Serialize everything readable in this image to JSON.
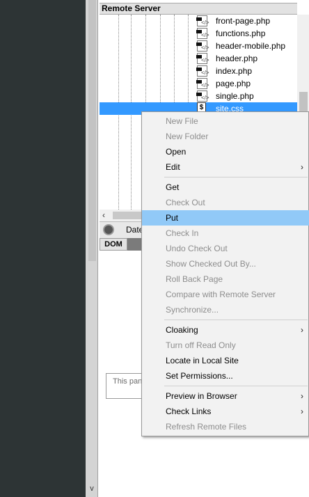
{
  "panel": {
    "title": "Remote Server",
    "files": [
      {
        "name": "front-page.php"
      },
      {
        "name": "functions.php"
      },
      {
        "name": "header-mobile.php"
      },
      {
        "name": "header.php"
      },
      {
        "name": "index.php"
      },
      {
        "name": "page.php"
      },
      {
        "name": "single.php"
      },
      {
        "name": "site.css"
      }
    ],
    "selected_file": "site.css",
    "date_column": "Date",
    "tab_dom": "DOM",
    "pane_placeholder": "This pan"
  },
  "context_menu": {
    "items": [
      {
        "label": "New File",
        "enabled": false
      },
      {
        "label": "New Folder",
        "enabled": false
      },
      {
        "label": "Open",
        "enabled": true
      },
      {
        "label": "Edit",
        "enabled": true,
        "submenu": true
      },
      {
        "label": "Get",
        "enabled": true
      },
      {
        "label": "Check Out",
        "enabled": false
      },
      {
        "label": "Put",
        "enabled": true,
        "highlighted": true
      },
      {
        "label": "Check In",
        "enabled": false
      },
      {
        "label": "Undo Check Out",
        "enabled": false
      },
      {
        "label": "Show Checked Out By...",
        "enabled": false
      },
      {
        "label": "Roll Back Page",
        "enabled": false
      },
      {
        "label": "Compare with Remote Server",
        "enabled": false
      },
      {
        "label": "Synchronize...",
        "enabled": false
      },
      {
        "label": "Cloaking",
        "enabled": true,
        "submenu": true
      },
      {
        "label": "Turn off Read Only",
        "enabled": false
      },
      {
        "label": "Locate in Local Site",
        "enabled": true
      },
      {
        "label": "Set Permissions...",
        "enabled": true
      },
      {
        "label": "Preview in Browser",
        "enabled": true,
        "submenu": true
      },
      {
        "label": "Check Links",
        "enabled": true,
        "submenu": true
      },
      {
        "label": "Refresh Remote Files",
        "enabled": false
      }
    ],
    "submenu_glyph": "›"
  },
  "icons": {
    "php_file": "php-file-icon",
    "css_file": "css-file-icon",
    "globe": "globe-icon",
    "scroll_left": "‹",
    "scroll_down": "v"
  },
  "colors": {
    "selection": "#3399ff",
    "menu_highlight": "#91c9f7",
    "disabled_text": "#8d8d8d",
    "dark_background": "#2d3435"
  }
}
